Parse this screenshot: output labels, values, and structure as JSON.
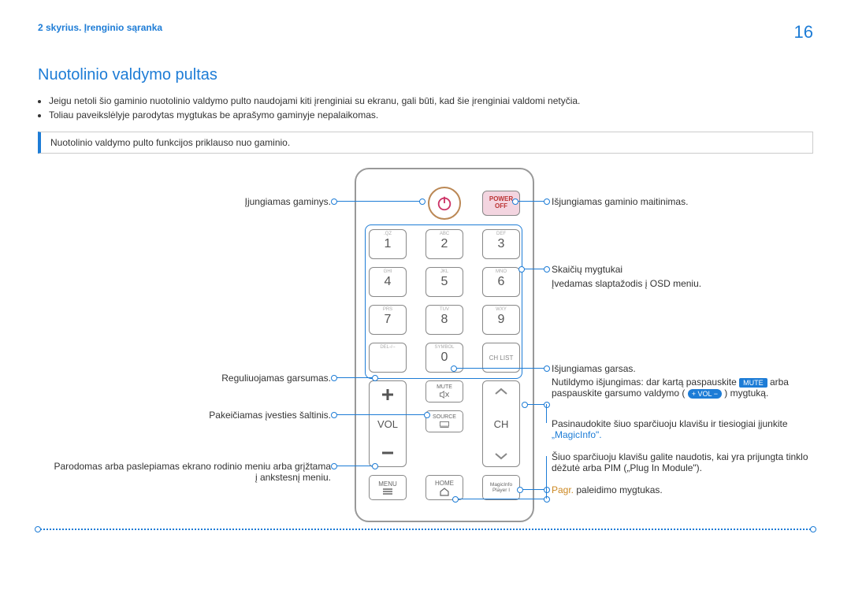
{
  "header": {
    "chapter": "2 skyrius. Įrenginio sąranka",
    "page": "16"
  },
  "title": "Nuotolinio valdymo pultas",
  "bullets": [
    "Jeigu netoli šio gaminio nuotolinio valdymo pulto naudojami kiti įrenginiai su ekranu, gali būti, kad šie įrenginiai valdomi netyčia.",
    "Toliau paveikslėlyje parodytas mygtukas be aprašymo gaminyje nepalaikomas."
  ],
  "note": "Nuotolinio valdymo pulto funkcijos priklauso nuo gaminio.",
  "remote": {
    "power_off_1": "POWER",
    "power_off_2": "OFF",
    "keys": [
      {
        "lbl": ".QZ",
        "n": "1"
      },
      {
        "lbl": "ABC",
        "n": "2"
      },
      {
        "lbl": "DEF",
        "n": "3"
      },
      {
        "lbl": "GHI",
        "n": "4"
      },
      {
        "lbl": "JKL",
        "n": "5"
      },
      {
        "lbl": "MNO",
        "n": "6"
      },
      {
        "lbl": "PRS",
        "n": "7"
      },
      {
        "lbl": "TUV",
        "n": "8"
      },
      {
        "lbl": "WXY",
        "n": "9"
      },
      {
        "lbl": "DEL-/--",
        "n": ""
      },
      {
        "lbl": "SYMBOL",
        "n": "0"
      },
      {
        "lbl": "",
        "n": "CH LIST"
      }
    ],
    "vol": "VOL",
    "ch": "CH",
    "mute": "MUTE",
    "source": "SOURCE",
    "menu": "MENU",
    "home": "HOME",
    "magic1": "MagicInfo",
    "magic2": "Player I"
  },
  "callouts": {
    "l1": "Įjungiamas gaminys.",
    "r1": "Išjungiamas gaminio maitinimas.",
    "r2a": "Skaičių mygtukai",
    "r2b": "Įvedamas slaptažodis į OSD meniu.",
    "l3": "Reguliuojamas garsumas.",
    "r3": "Išjungiamas garsas.",
    "r3b_a": "Nutildymo išjungimas: dar kartą paspauskite ",
    "r3b_mute": "MUTE",
    "r3b_b": " arba",
    "r3c_a": "paspauskite garsumo valdymo (",
    "r3c_vol": "+ VOL −",
    "r3c_b": ") mygtuką.",
    "l4": "Pakeičiamas įvesties šaltinis.",
    "r5a": "Pasinaudokite šiuo sparčiuoju klavišu ir tiesiogiai įjunkite",
    "r5b": "„MagicInfo\".",
    "l6a": "Parodomas arba paslepiamas ekrano rodinio meniu arba grįžtama",
    "l6b": "į ankstesnį meniu.",
    "r6a": "Šiuo sparčiuoju klavišu galite naudotis, kai yra prijungta tinklo",
    "r6b": "dėžutė arba PIM („Plug In Module\").",
    "r7a": "Pagr.",
    "r7b": " paleidimo mygtukas."
  }
}
